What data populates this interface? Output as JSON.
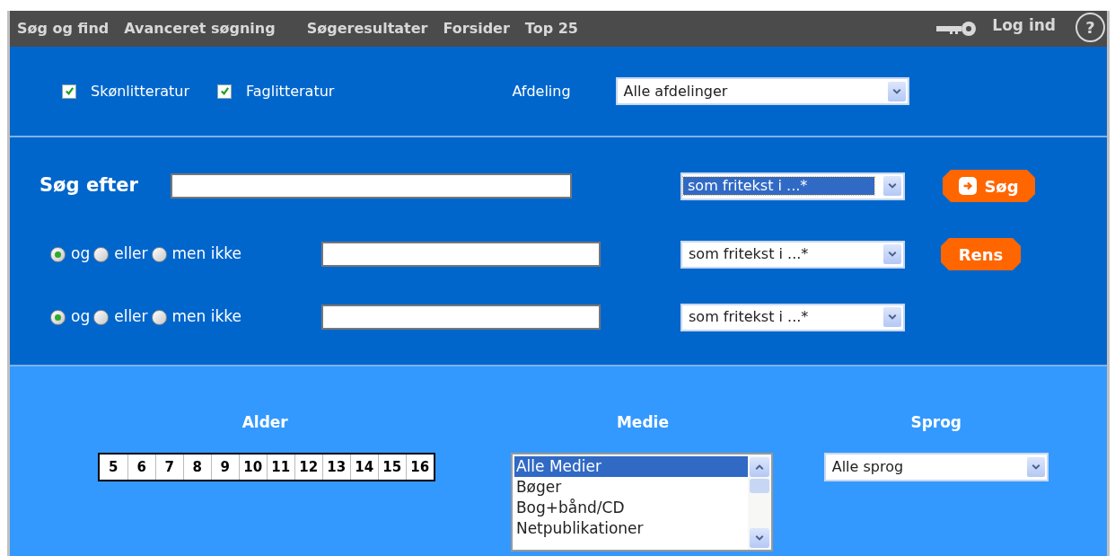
{
  "nav": {
    "items": [
      {
        "label": "Søg og find"
      },
      {
        "label": "Avanceret søgning"
      },
      {
        "label": "Søgeresultater"
      },
      {
        "label": "Forsider"
      },
      {
        "label": "Top 25"
      }
    ],
    "login": "Log ind",
    "help": "?"
  },
  "filters": {
    "checkboxes": [
      {
        "label": "Skønlitteratur",
        "checked": true
      },
      {
        "label": "Faglitteratur",
        "checked": true
      }
    ],
    "department": {
      "label": "Afdeling",
      "value": "Alle afdelinger"
    }
  },
  "search": {
    "label": "Søg efter",
    "scope": {
      "value": "som fritekst i ...*",
      "focused": true
    },
    "buttons": [
      {
        "label": "Søg",
        "kind": "arrow"
      },
      {
        "label": "Rens",
        "kind": "plain"
      }
    ]
  },
  "rows": [
    {
      "operators": [
        {
          "label": "og",
          "selected": true
        },
        {
          "label": "eller",
          "selected": false
        },
        {
          "label": "men ikke",
          "selected": false
        }
      ],
      "scope": {
        "value": "som fritekst i ...*",
        "focused": false
      }
    },
    {
      "operators": [
        {
          "label": "og",
          "selected": true
        },
        {
          "label": "eller",
          "selected": false
        },
        {
          "label": "men ikke",
          "selected": false
        }
      ],
      "scope": {
        "value": "som fritekst i ...*",
        "focused": false
      }
    }
  ],
  "facets": {
    "age": {
      "title": "Alder",
      "values": [
        "5",
        "6",
        "7",
        "8",
        "9",
        "10",
        "11",
        "12",
        "13",
        "14",
        "15",
        "16"
      ]
    },
    "media": {
      "title": "Medie",
      "options": [
        {
          "label": "Alle Medier",
          "selected": true
        },
        {
          "label": "Bøger",
          "selected": false
        },
        {
          "label": "Bog+bånd/CD",
          "selected": false
        },
        {
          "label": "Netpublikationer",
          "selected": false
        }
      ]
    },
    "language": {
      "title": "Sprog",
      "value": "Alle sprog"
    }
  }
}
